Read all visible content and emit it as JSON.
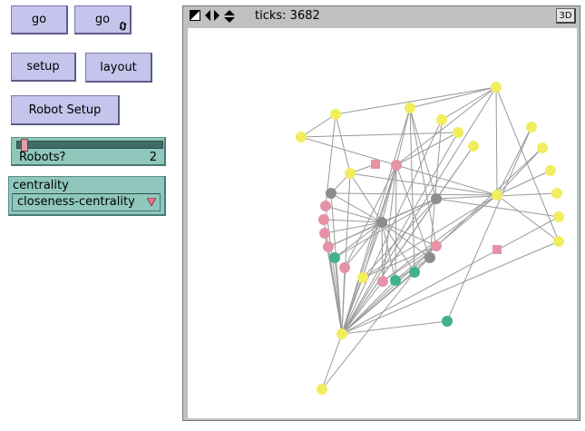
{
  "buttons": {
    "go": "go",
    "go_forever": "go",
    "setup": "setup",
    "layout": "layout",
    "robot_setup": "Robot Setup"
  },
  "slider": {
    "label": "Robots?",
    "value": 2,
    "min": 0,
    "max": 30
  },
  "chooser": {
    "label": "centrality",
    "value": "closeness-centrality"
  },
  "view": {
    "ticks_label": "ticks: 3682",
    "btn_3d": "3D"
  },
  "colors": {
    "yellow": "#f0ee5e",
    "pink": "#e593a6",
    "gray": "#8d8d8d",
    "green": "#3fb28c",
    "edge": "#9a9a9a",
    "button": "#c4c4ec",
    "widget": "#8fc7bc"
  },
  "icons": {
    "forever": "forever-loop-icon",
    "dropdown": "dropdown-triangle-icon",
    "view_controls": [
      "size-toggle-icon",
      "horizontal-arrows-icon",
      "vertical-arrows-icon"
    ]
  }
}
